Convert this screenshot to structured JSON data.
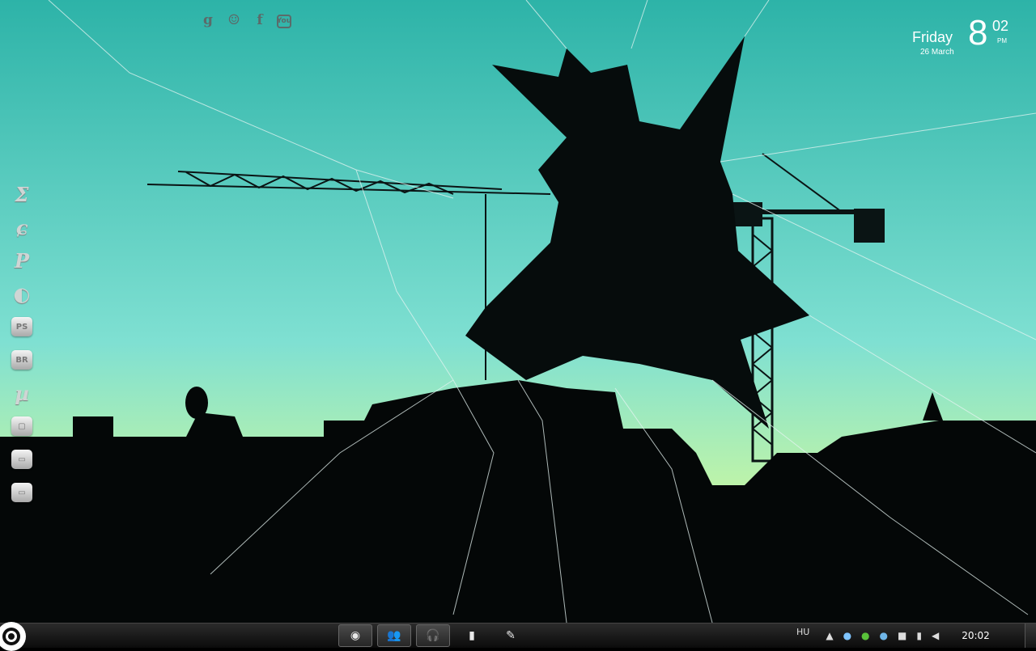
{
  "clock": {
    "day": "Friday",
    "date": "26 March",
    "hour": "8",
    "minutes": "02",
    "ampm": "PM"
  },
  "social_icons": [
    {
      "name": "google-icon",
      "glyph": "g"
    },
    {
      "name": "devil-icon",
      "glyph": "☺"
    },
    {
      "name": "facebook-icon",
      "glyph": "f"
    },
    {
      "name": "youtube-icon",
      "glyph": "You"
    }
  ],
  "dock_items": [
    {
      "name": "dock-item-1",
      "glyph": "Ʃ"
    },
    {
      "name": "dock-item-2",
      "glyph": "ɕ"
    },
    {
      "name": "dock-item-3",
      "glyph": "P"
    },
    {
      "name": "dock-item-4",
      "glyph": "◐"
    },
    {
      "name": "dock-item-photoshop",
      "glyph": "PS"
    },
    {
      "name": "dock-item-bridge",
      "glyph": "BR"
    },
    {
      "name": "dock-item-utorrent",
      "glyph": "µ"
    },
    {
      "name": "dock-item-8",
      "glyph": "▢"
    },
    {
      "name": "dock-item-folder",
      "glyph": "▭"
    },
    {
      "name": "dock-item-computer",
      "glyph": "▭"
    }
  ],
  "taskbar": {
    "pinned": [
      "◉",
      "👥",
      "🎧",
      "▮",
      "✎"
    ],
    "language": "HU",
    "time": "20:02"
  },
  "colors": {
    "sky_top": "#2cb4a8",
    "sky_bottom": "#b9f4a0",
    "silhouette": "#050a0a",
    "taskbar": "#1a1a1a"
  }
}
